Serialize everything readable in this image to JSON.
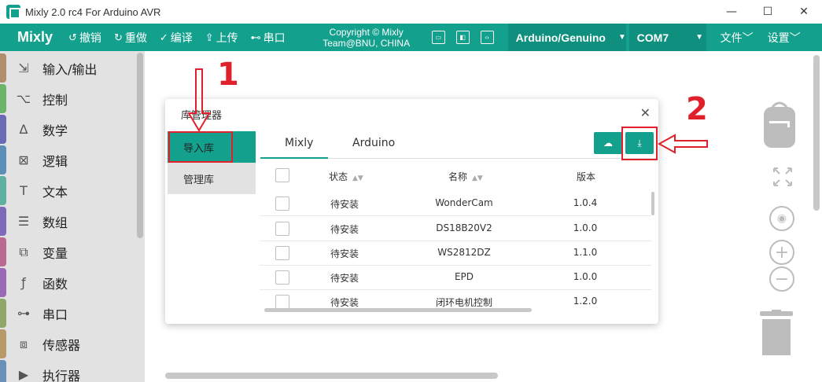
{
  "window": {
    "title": "Mixly 2.0 rc4 For Arduino AVR",
    "minimize": "—",
    "maximize": "☐",
    "close": "✕"
  },
  "toolbar": {
    "brand": "Mixly",
    "items": [
      {
        "icon": "undo-icon",
        "glyph": "↺",
        "label": "撤销"
      },
      {
        "icon": "redo-icon",
        "glyph": "↻",
        "label": "重做"
      },
      {
        "icon": "check-icon",
        "glyph": "✓",
        "label": "编译"
      },
      {
        "icon": "upload-icon",
        "glyph": "⇪",
        "label": "上传"
      },
      {
        "icon": "usb-icon",
        "glyph": "⊷",
        "label": "串口"
      }
    ],
    "copyright_line1": "Copyright © Mixly",
    "copyright_line2": "Team@BNU, CHINA",
    "board": "Arduino/Genuino",
    "port": "COM7",
    "file_menu": "文件﹀",
    "settings_menu": "设置﹀"
  },
  "sidebar": {
    "items": [
      {
        "label": "输入/输出",
        "color": "#b08d6d",
        "glyph": "⇲"
      },
      {
        "label": "控制",
        "color": "#6ab56a",
        "glyph": "⌥"
      },
      {
        "label": "数学",
        "color": "#6a6ab5",
        "glyph": "∆"
      },
      {
        "label": "逻辑",
        "color": "#5b8fb8",
        "glyph": "⊠"
      },
      {
        "label": "文本",
        "color": "#5fb0a0",
        "glyph": "T"
      },
      {
        "label": "数组",
        "color": "#7f6ab8",
        "glyph": "☰"
      },
      {
        "label": "变量",
        "color": "#b86a8f",
        "glyph": "⧉"
      },
      {
        "label": "函数",
        "color": "#9a6ab8",
        "glyph": "ƒ"
      },
      {
        "label": "串口",
        "color": "#8fa86a",
        "glyph": "⊶"
      },
      {
        "label": "传感器",
        "color": "#b89a6a",
        "glyph": "⧈"
      },
      {
        "label": "执行器",
        "color": "#6a8fb8",
        "glyph": "▶"
      }
    ]
  },
  "dialog": {
    "title": "库管理器",
    "close": "✕",
    "nav": [
      "导入库",
      "管理库"
    ],
    "tabs": [
      "Mixly",
      "Arduino"
    ],
    "columns": {
      "status": "状态",
      "name": "名称",
      "version": "版本"
    },
    "sort_glyph": "▲▼",
    "rows": [
      {
        "status": "待安装",
        "name": "WonderCam",
        "version": "1.0.4"
      },
      {
        "status": "待安装",
        "name": "DS18B20V2",
        "version": "1.0.0"
      },
      {
        "status": "待安装",
        "name": "WS2812DZ",
        "version": "1.1.0"
      },
      {
        "status": "待安装",
        "name": "EPD",
        "version": "1.0.0"
      },
      {
        "status": "待安装",
        "name": "闭环电机控制",
        "version": "1.2.0"
      }
    ]
  },
  "annotations": {
    "one": "1",
    "two": "2",
    "color": "#e0202a"
  },
  "colors": {
    "accent": "#13a08c",
    "sidebar_bg": "#e2e2e2"
  }
}
